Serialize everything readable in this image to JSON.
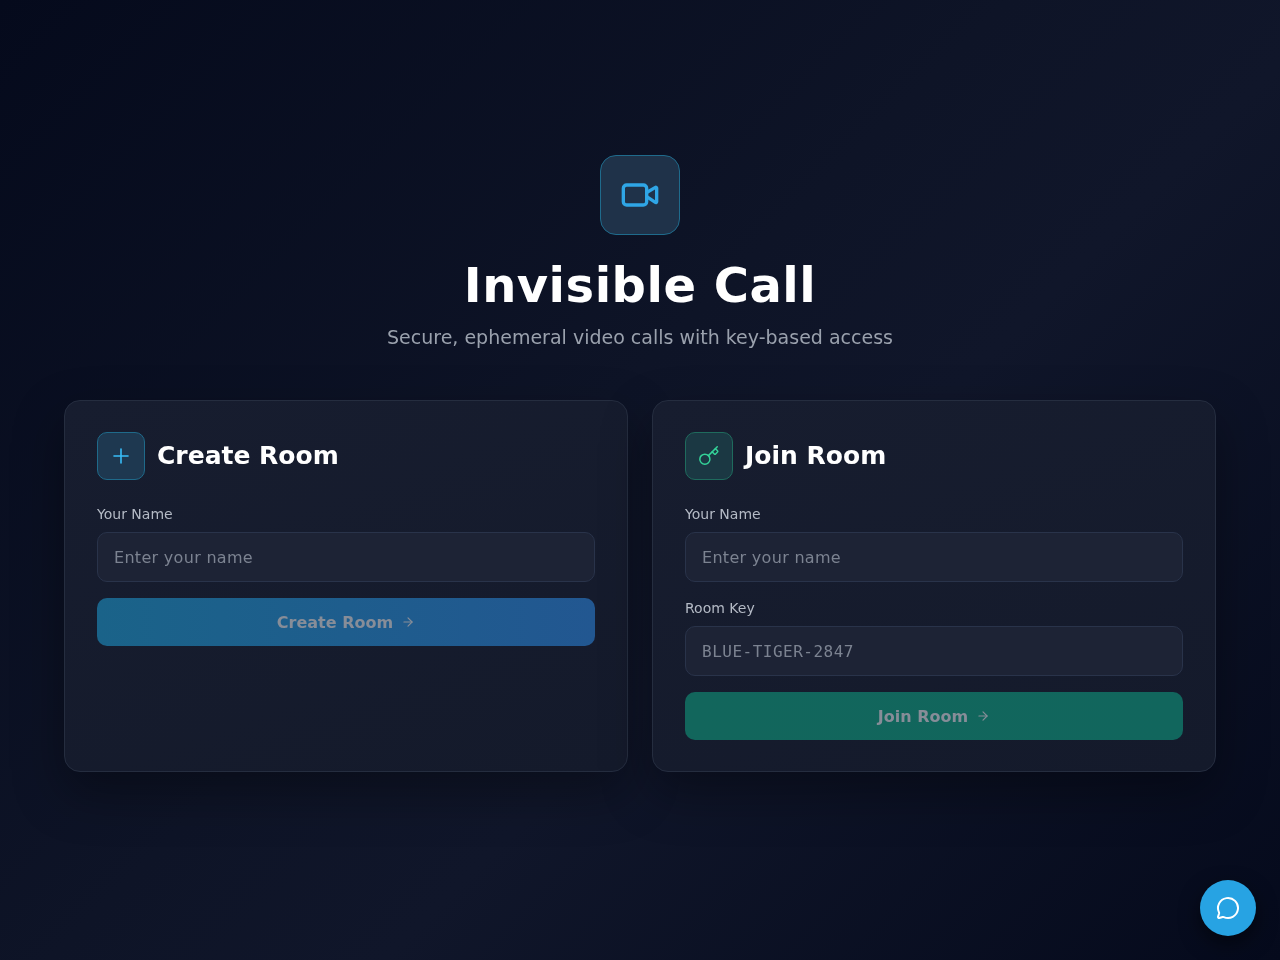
{
  "header": {
    "title": "Invisible Call",
    "subtitle": "Secure, ephemeral video calls with key-based access"
  },
  "cards": [
    {
      "kind": "create",
      "title": "Create Room",
      "fields": [
        {
          "kind": "text",
          "label": "Your Name",
          "placeholder": "Enter your name"
        }
      ],
      "button": {
        "label": "Create Room",
        "disabled": true
      }
    },
    {
      "kind": "join",
      "title": "Join Room",
      "fields": [
        {
          "kind": "text",
          "label": "Your Name",
          "placeholder": "Enter your name"
        },
        {
          "kind": "code",
          "label": "Room Key",
          "placeholder": "BLUE-TIGER-2847"
        }
      ],
      "button": {
        "label": "Join Room",
        "disabled": true
      }
    }
  ]
}
